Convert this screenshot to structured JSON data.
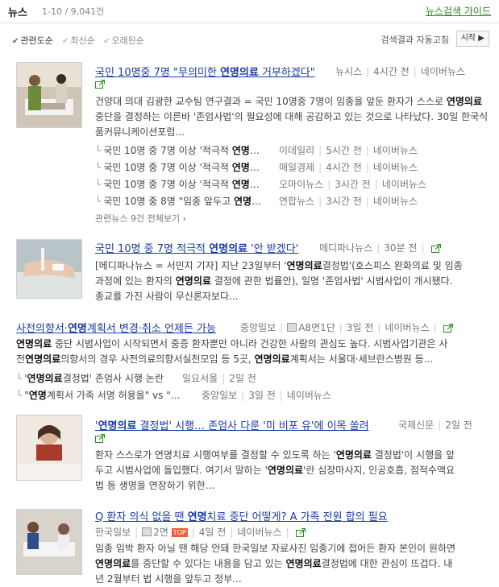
{
  "header": {
    "title": "뉴스",
    "count": "1-10 / 9,041건",
    "guide": "뉴스검색 가이드"
  },
  "sort": {
    "options": [
      "관련도순",
      "최신순",
      "오래된순"
    ],
    "auto_label": "검색결과 자동고침",
    "start_label": "시작"
  },
  "items": [
    {
      "title_pre": "국민 10명중 7명 \"무의미한 ",
      "title_bold": "연명의료",
      "title_post": " 거부하겠다\"",
      "source": "뉴시스",
      "time": "4시간 전",
      "naver": "네이버뉴스",
      "body": [
        {
          "t": "건양대 의대 김광한 교수팀 연구결과 = 국민 10명중 7명이 임종을 앞둔 환자가 스스로 "
        },
        {
          "b": "연명"
        },
        {
          "t": "의료"
        },
        {
          "t": " 중단을 결정하는 이른바 '존엄사법'의 필요성에 대해 공감하고 있는 것으로 나타났다. 30일 한국식품커뮤니케이션포럼..."
        }
      ],
      "related": [
        {
          "pre": "국민 10명 중 7명 이상 '적극적 ",
          "bold": "연명",
          "post": "…",
          "source": "이데일리",
          "time": "5시간 전",
          "naver": "네이버뉴스"
        },
        {
          "pre": "국민 10명 중 7명 이상 '적극적 ",
          "bold": "연명",
          "post": "…",
          "source": "매일경제",
          "time": "4시간 전",
          "naver": "네이버뉴스"
        },
        {
          "pre": "국민 10명 중 7명 이상 '적극적 ",
          "bold": "연명",
          "post": "…",
          "source": "오마이뉴스",
          "time": "3시간 전",
          "naver": "네이버뉴스"
        },
        {
          "pre": "국민 10명 중 8명 \"임종 앞두고 ",
          "bold": "연명",
          "post": "…",
          "source": "연합뉴스",
          "time": "3시간 전",
          "naver": "네이버뉴스"
        }
      ],
      "more": "관련뉴스 9건 전체보기"
    },
    {
      "title_pre": "국민 10명 중 7명 적극적 ",
      "title_bold": "연명의료",
      "title_post": " '안 받겠다'",
      "source": "메디파나뉴스",
      "time": "30분 전",
      "body_l1a": "[메디파나뉴스 = 서민지 기자] 지난 23일부터 '",
      "body_l1b": "연명의료",
      "body_l1c": "결정법'(호스피스 완화의료 및 임종",
      "body_l2a": "과정에 있는 환자의 ",
      "body_l2b": "연명의료",
      "body_l2c": " 결정에 관한 법률안), 일명 '존엄사법' 시범사업이 개시됐다.",
      "body_l3": "종교를 가진 사람이 무신론자보다..."
    },
    {
      "title_a": "사전의향서·",
      "title_b": "연명",
      "title_c": "계획서 변경·취소 언제든 가능",
      "source": "중앙일보",
      "paper": "A8면1단",
      "time": "3일 전",
      "naver": "네이버뉴스",
      "l1a": "",
      "l1b": "연명의료",
      "l1c": " 중단 시범사업이 시작되면서 중증 환자뿐만 아니라 건강한 사람의 관심도 높다. 시범사업기관은 사",
      "l2a": "전",
      "l2b": "연명의료",
      "l2c": "의향서의 경우 사전의료의향서실천모임 등 5곳, ",
      "l2d": "연명의료",
      "l2e": "계획서는 서울대·세브란스병원 등...",
      "related": [
        {
          "pre": "'",
          "bold": "연명의료",
          "post": "결정법' 존엄사 시행 논란",
          "source": "일요서울",
          "time": "2일 전"
        },
        {
          "pre": "\"",
          "bold": "연명",
          "post": "계획서 가족 서명 허용을\" vs \"…",
          "source": "중앙일보",
          "time": "3일 전",
          "naver": "네이버뉴스"
        }
      ]
    },
    {
      "title_a": "'",
      "title_b": "연명의료",
      "title_c": " 결정법' 시행… 존엄사 다룬 '미 비포 유'에 이목 쏠려",
      "source": "국제신문",
      "time": "2일 전",
      "l1a": "환자 스스로가 연명치료 시행여부를 결정할 수 있도록 하는 '",
      "l1b": "연명의료",
      "l1c": " 결정법'이 시행을 앞",
      "l2": "두고 시범사업에 돌입했다. 여기서 말하는 '",
      "l2b": "연명의료",
      "l2c": "'란 심장마사지, 인공호흡, 점적수액요",
      "l3": "법 등 생명을 연장하기 위한..."
    },
    {
      "title_a": "Q 환자 의식 없을 땐 ",
      "title_b": "연명",
      "title_c": "치료 중단 어떻게? A 가족 전원 합의 필요",
      "source": "한국일보",
      "paper": "2면",
      "tof": "TOP",
      "time": "4일 전",
      "naver": "네이버뉴스",
      "l1": "임종 임박 환자 아닐 땐 해당 안돼 한국일보 자료사진 임종기에 접어든 환자 본인이 원하면",
      "l2b": "연명의료",
      "l2c": "를 중단할 수 있다는 내용을 담고 있는 ",
      "l2d": "연명의료",
      "l2e": "결정법에 대한 관심이 뜨겁다. 내",
      "l3": "년 2월부터 법 시행을 앞두고 정부..."
    }
  ]
}
